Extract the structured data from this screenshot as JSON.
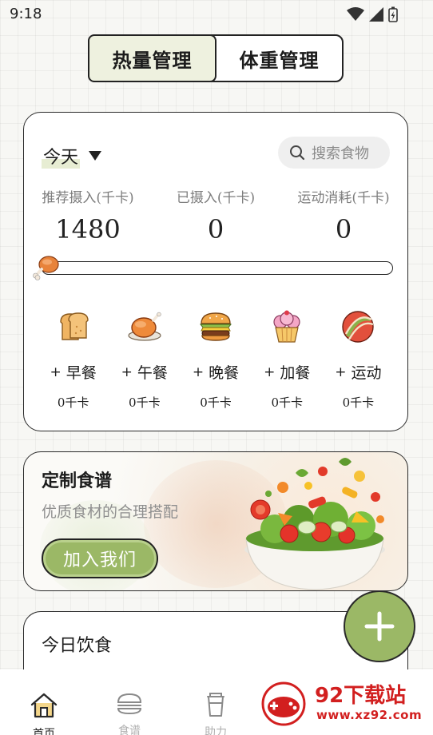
{
  "status_bar": {
    "time": "9:18"
  },
  "tabs": [
    {
      "label": "热量管理",
      "active": true
    },
    {
      "label": "体重管理",
      "active": false
    }
  ],
  "summary": {
    "day": "今天",
    "search_placeholder": "搜索食物",
    "stats": [
      {
        "label": "推荐摄入(千卡)",
        "value": "1480"
      },
      {
        "label": "已摄入(千卡)",
        "value": "0"
      },
      {
        "label": "运动消耗(千卡)",
        "value": "0"
      }
    ],
    "progress": 0,
    "meals": [
      {
        "icon": "bread-icon",
        "label": "早餐",
        "plus": "+",
        "kcal": "0千卡"
      },
      {
        "icon": "roast-chicken-icon",
        "label": "午餐",
        "plus": "+",
        "kcal": "0千卡"
      },
      {
        "icon": "burger-icon",
        "label": "晚餐",
        "plus": "+",
        "kcal": "0千卡"
      },
      {
        "icon": "cupcake-icon",
        "label": "加餐",
        "plus": "+",
        "kcal": "0千卡"
      },
      {
        "icon": "ball-icon",
        "label": "运动",
        "plus": "+",
        "kcal": "0千卡"
      }
    ]
  },
  "banner": {
    "title": "定制食谱",
    "subtitle": "优质食材的合理搭配",
    "button": "加入我们"
  },
  "diet": {
    "title": "今日饮食"
  },
  "bottom_nav": [
    {
      "label": "首页",
      "icon": "home-icon",
      "active": true
    },
    {
      "label": "食谱",
      "icon": "burger-outline-icon",
      "active": false
    },
    {
      "label": "助力",
      "icon": "cup-icon",
      "active": false
    }
  ],
  "watermark": {
    "text": "92下载站",
    "url": "www.xz92.com"
  },
  "colors": {
    "accent": "#9bb866",
    "tab_active_bg": "#eef1df",
    "watermark": "#d21f1f"
  }
}
